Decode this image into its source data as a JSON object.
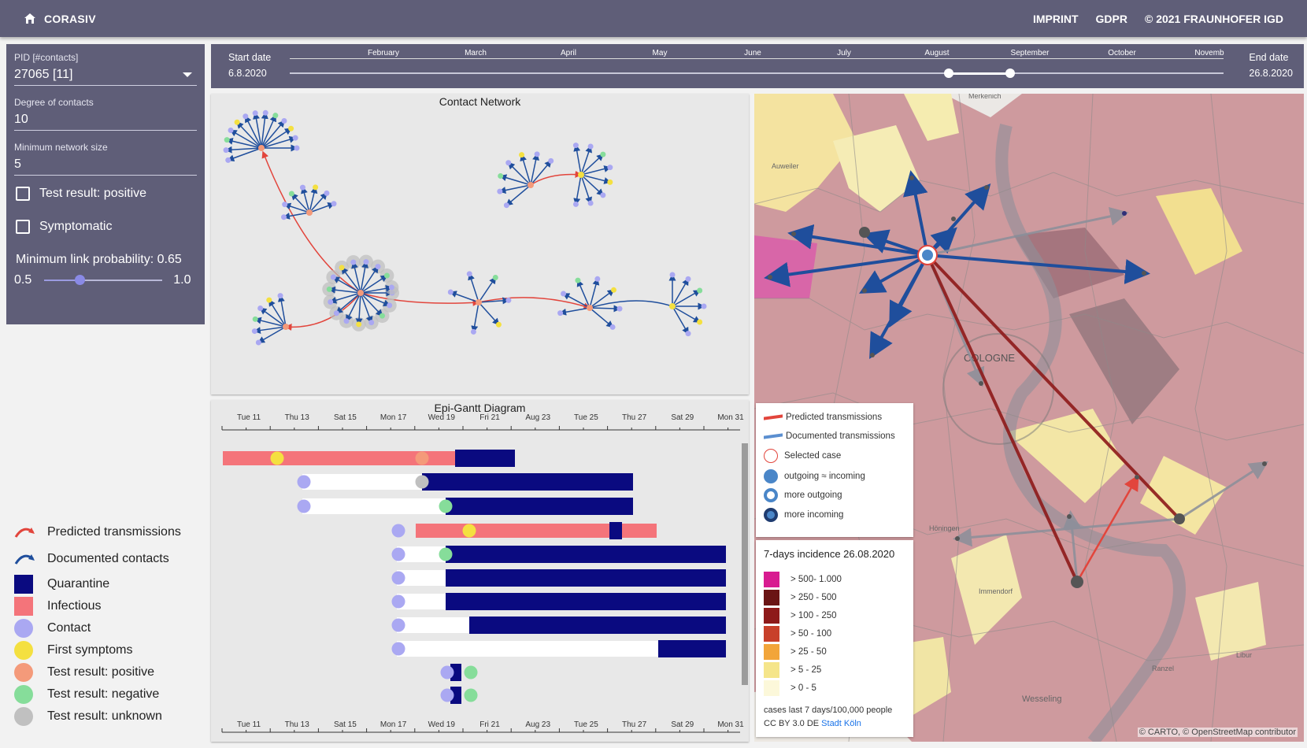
{
  "header": {
    "app_name": "CORASIV",
    "nav": [
      "IMPRINT",
      "GDPR",
      "© 2021 FRAUNHOFER IGD"
    ]
  },
  "filters": {
    "pid_label": "PID [#contacts]",
    "pid_value": "27065 [11]",
    "degree_label": "Degree of contacts",
    "degree_value": "10",
    "minsize_label": "Minimum network size",
    "minsize_value": "5",
    "check_positive": "Test result: positive",
    "check_symptomatic": "Symptomatic",
    "min_link_label": "Minimum link probability: 0.65",
    "min_link_value": 0.65,
    "slider_min": "0.5",
    "slider_max": "1.0"
  },
  "legend": {
    "predicted": "Predicted transmissions",
    "documented": "Documented contacts",
    "quarantine": "Quarantine",
    "infectious": "Infectious",
    "contact": "Contact",
    "first_symptoms": "First symptoms",
    "test_positive": "Test result: positive",
    "test_negative": "Test result: negative",
    "test_unknown": "Test result: unknown"
  },
  "colors": {
    "topbar": "#5f5e78",
    "quarantine": "#0a0a80",
    "infectious": "#f4747a",
    "contact": "#aaa8f2",
    "first_symptoms": "#f4e040",
    "test_positive": "#f49a7a",
    "test_negative": "#86dd9a",
    "test_unknown": "#c0c0c0",
    "predicted": "#e2453c",
    "documented": "#1f4e9c"
  },
  "timeline": {
    "start_label": "Start date",
    "start_value": "6.8.2020",
    "end_label": "End date",
    "end_value": "26.8.2020",
    "months": [
      "February",
      "March",
      "April",
      "May",
      "June",
      "July",
      "August",
      "September",
      "October",
      "Novemb"
    ]
  },
  "network": {
    "title": "Contact Network"
  },
  "gantt": {
    "title": "Epi-Gantt Diagram",
    "days": [
      "Tue 11",
      "Thu 13",
      "Sat 15",
      "Mon 17",
      "Wed 19",
      "Fri 21",
      "Aug 23",
      "Tue 25",
      "Thu 27",
      "Sat 29",
      "Mon 31"
    ]
  },
  "map": {
    "labels": [
      "Merkenich",
      "Auweiler",
      "COLOGNE",
      "Höningen",
      "Immendorf",
      "Libur",
      "Ranzel",
      "Wesseling"
    ],
    "legend": {
      "predicted": "Predicted transmissions",
      "documented": "Documented transmissions",
      "selected": "Selected case",
      "equal": "outgoing ≈ incoming",
      "more_out": "more outgoing",
      "more_in": "more incoming"
    },
    "incidence_title": "7-days incidence 26.08.2020",
    "incidence_ranges": [
      {
        "label": "> 500- 1.000",
        "color": "#d81b90"
      },
      {
        "label": "> 250 - 500",
        "color": "#6a1414"
      },
      {
        "label": "> 100 - 250",
        "color": "#8e1a1a"
      },
      {
        "label": "> 50 - 100",
        "color": "#c8402a"
      },
      {
        "label": "> 25 - 50",
        "color": "#f2a53a"
      },
      {
        "label": "> 5 - 25",
        "color": "#f5e58a"
      },
      {
        "label": "> 0 - 5",
        "color": "#fcf8da"
      }
    ],
    "incidence_note": "cases last 7 days/100,000 people",
    "license": "CC BY 3.0 DE",
    "license_link": "Stadt Köln",
    "attribution": "© CARTO, © OpenStreetMap contributor"
  }
}
